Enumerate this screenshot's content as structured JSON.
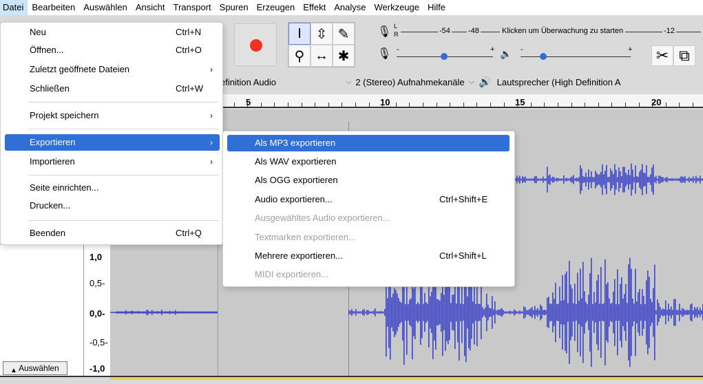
{
  "menubar": [
    "Datei",
    "Bearbeiten",
    "Auswählen",
    "Ansicht",
    "Transport",
    "Spuren",
    "Erzeugen",
    "Effekt",
    "Analyse",
    "Werkzeuge",
    "Hilfe"
  ],
  "toolbar": {
    "meter_scale": [
      "-54",
      "-48",
      "-12"
    ],
    "meter_message": "Klicken um Überwachung zu starten",
    "left_label": "L",
    "right_label": "R",
    "plus": "+",
    "minus": "-"
  },
  "devices": {
    "playback_host": "efinition Audio",
    "channels": "2 (Stereo) Aufnahmekanäle",
    "output": "Lautsprecher (High Definition A"
  },
  "ruler": [
    "5",
    "10",
    "15",
    "20"
  ],
  "track": {
    "select_label": "Auswählen",
    "scale": [
      "1,0",
      "0,5-",
      "0,0-",
      "-0,5-",
      "-1,0"
    ]
  },
  "file_menu": {
    "items": [
      {
        "label": "Neu",
        "shortcut": "Ctrl+N"
      },
      {
        "label": "Öffnen...",
        "shortcut": "Ctrl+O"
      },
      {
        "label": "Zuletzt geöffnete Dateien",
        "submenu": true
      },
      {
        "label": "Schließen",
        "shortcut": "Ctrl+W"
      },
      {
        "label": "Projekt speichern",
        "submenu": true
      },
      {
        "label": "Exportieren",
        "submenu": true,
        "highlighted": true
      },
      {
        "label": "Importieren",
        "submenu": true
      },
      {
        "label": "Seite einrichten..."
      },
      {
        "label": "Drucken..."
      },
      {
        "label": "Beenden",
        "shortcut": "Ctrl+Q"
      }
    ],
    "arrow": "›"
  },
  "export_menu": {
    "items": [
      {
        "label": "Als MP3 exportieren",
        "highlighted": true
      },
      {
        "label": "Als WAV exportieren"
      },
      {
        "label": "Als OGG exportieren"
      },
      {
        "label": "Audio exportieren...",
        "shortcut": "Ctrl+Shift+E"
      },
      {
        "label": "Ausgewähltes Audio exportieren...",
        "disabled": true
      },
      {
        "label": "Textmarken exportieren...",
        "disabled": true
      },
      {
        "label": "Mehrere exportieren...",
        "shortcut": "Ctrl+Shift+L"
      },
      {
        "label": "MIDI exportieren...",
        "disabled": true
      }
    ]
  },
  "colors": {
    "accent": "#2f6fd6",
    "waveform": "#3c45c8",
    "record": "#e33322",
    "track_bg": "#c9c9c9"
  }
}
